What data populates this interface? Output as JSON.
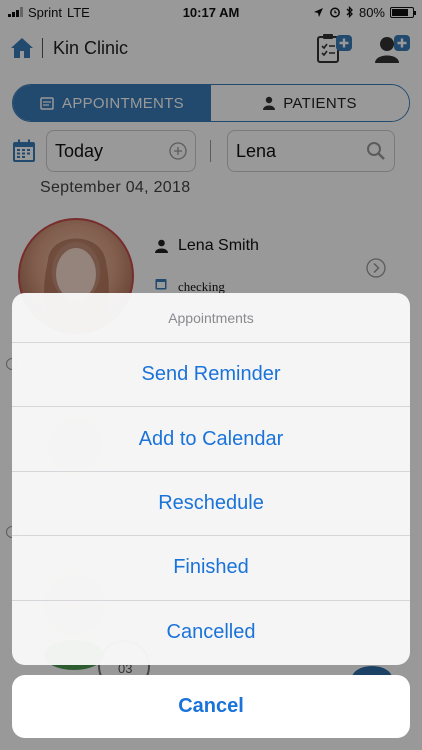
{
  "status_bar": {
    "carrier": "Sprint",
    "network": "LTE",
    "time": "10:17 AM",
    "battery": "80%",
    "battery_level": 0.8
  },
  "header": {
    "title": "Kin Clinic"
  },
  "tabs": [
    {
      "label": "APPOINTMENTS",
      "active": true
    },
    {
      "label": "PATIENTS",
      "active": false
    }
  ],
  "filters": {
    "date_value": "Today",
    "search_value": "Lena"
  },
  "date_heading": "September 04, 2018",
  "appointment": {
    "patient_name": "Lena Smith",
    "note": "checking"
  },
  "background_fragments": {
    "number": "03"
  },
  "action_sheet": {
    "title": "Appointments",
    "options": [
      "Send Reminder",
      "Add to Calendar",
      "Reschedule",
      "Finished",
      "Cancelled"
    ],
    "cancel_label": "Cancel"
  },
  "colors": {
    "accent": "#3a7ab8",
    "action_text": "#1a73d9",
    "avatar_border": "#c94b4b"
  }
}
